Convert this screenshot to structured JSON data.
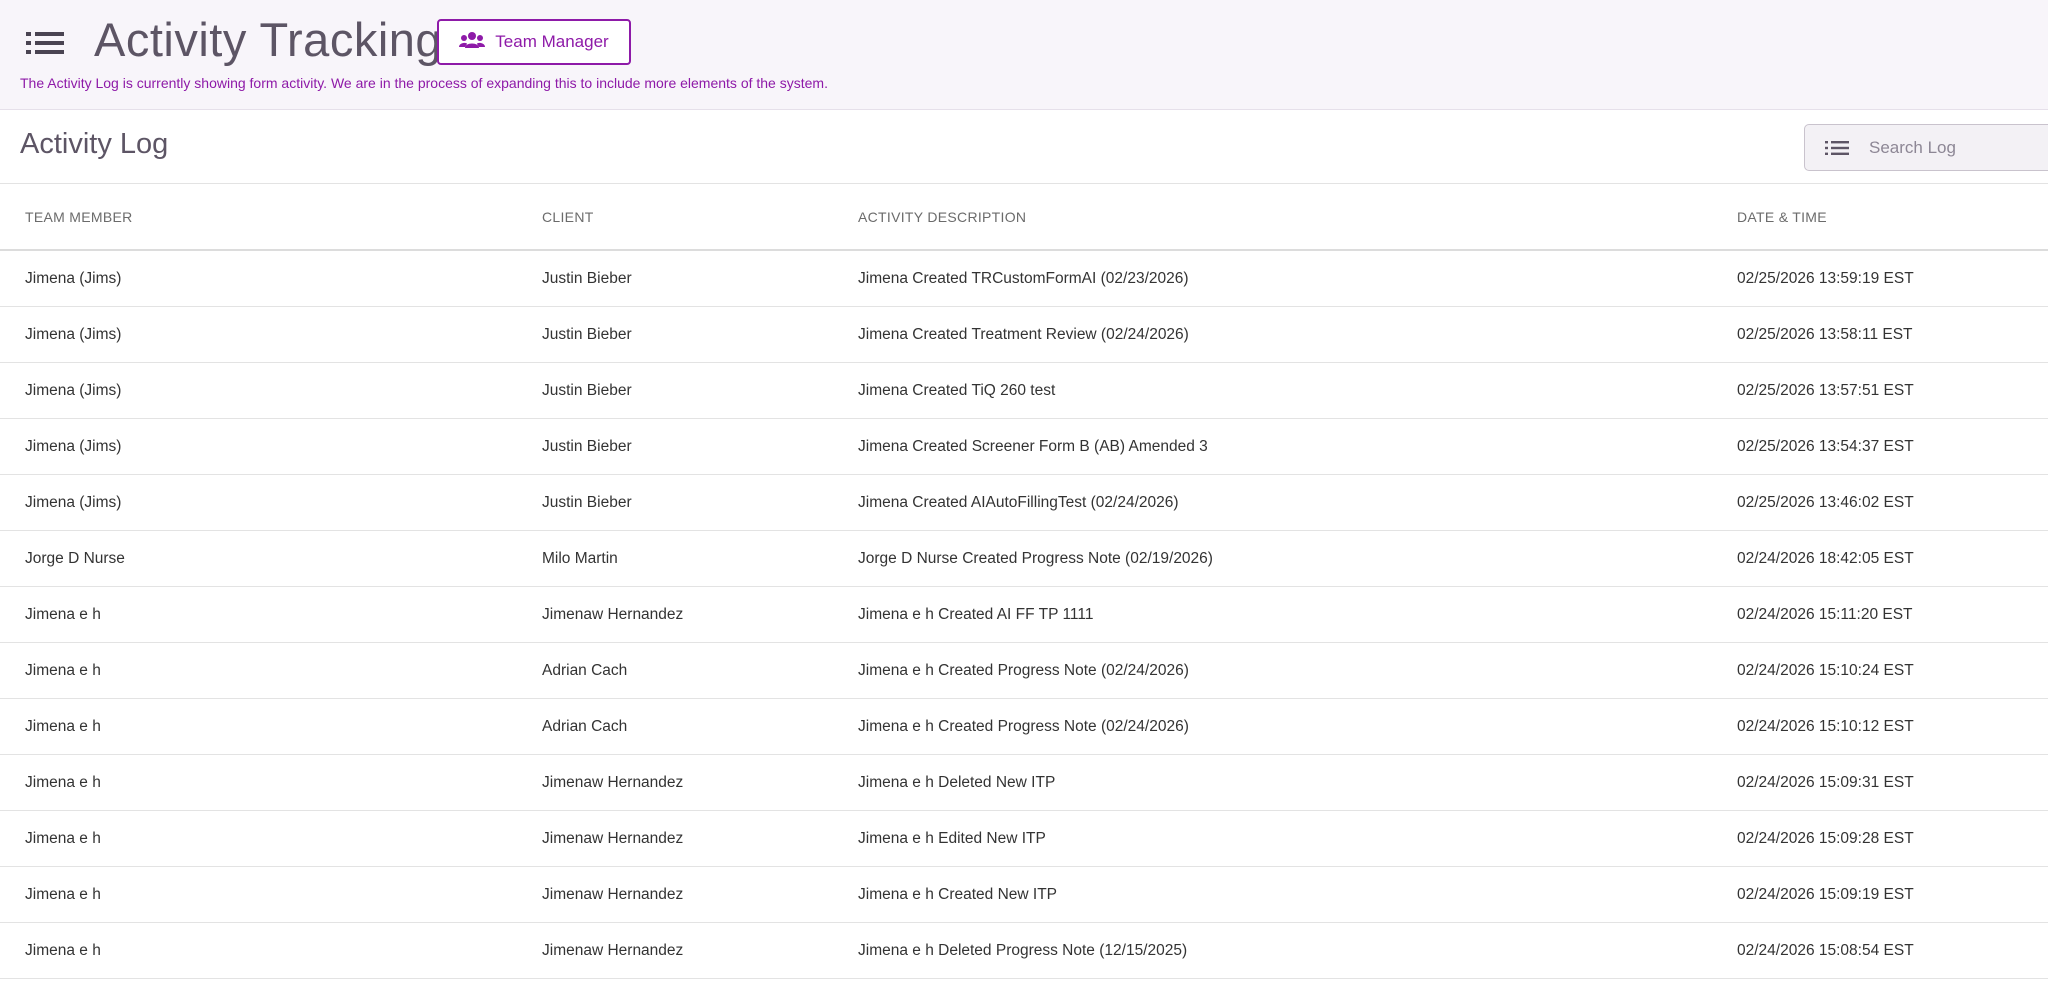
{
  "header": {
    "title": "Activity Tracking",
    "team_manager_label": "Team Manager",
    "notice": "The Activity Log is currently showing form activity. We are in the process of expanding this to include more elements of the system.",
    "accent_color": "#8e1aa8"
  },
  "log": {
    "title": "Activity Log",
    "search_placeholder": "Search Log"
  },
  "table": {
    "columns": [
      "TEAM MEMBER",
      "CLIENT",
      "ACTIVITY DESCRIPTION",
      "DATE & TIME"
    ],
    "rows": [
      [
        "Jimena (Jims)",
        "Justin Bieber",
        "Jimena Created TRCustomFormAI (02/23/2026)",
        "02/25/2026 13:59:19 EST"
      ],
      [
        "Jimena (Jims)",
        "Justin Bieber",
        "Jimena Created Treatment Review (02/24/2026)",
        "02/25/2026 13:58:11 EST"
      ],
      [
        "Jimena (Jims)",
        "Justin Bieber",
        "Jimena Created TiQ 260 test",
        "02/25/2026 13:57:51 EST"
      ],
      [
        "Jimena (Jims)",
        "Justin Bieber",
        "Jimena Created Screener Form B (AB) Amended 3",
        "02/25/2026 13:54:37 EST"
      ],
      [
        "Jimena (Jims)",
        "Justin Bieber",
        "Jimena Created AIAutoFillingTest (02/24/2026)",
        "02/25/2026 13:46:02 EST"
      ],
      [
        "Jorge D Nurse",
        "Milo Martin",
        "Jorge D Nurse Created Progress Note (02/19/2026)",
        "02/24/2026 18:42:05 EST"
      ],
      [
        "Jimena e h",
        "Jimenaw Hernandez",
        "Jimena e h Created AI FF TP 1111",
        "02/24/2026 15:11:20 EST"
      ],
      [
        "Jimena e h",
        "Adrian Cach",
        "Jimena e h Created Progress Note (02/24/2026)",
        "02/24/2026 15:10:24 EST"
      ],
      [
        "Jimena e h",
        "Adrian Cach",
        "Jimena e h Created Progress Note (02/24/2026)",
        "02/24/2026 15:10:12 EST"
      ],
      [
        "Jimena e h",
        "Jimenaw Hernandez",
        "Jimena e h Deleted New ITP",
        "02/24/2026 15:09:31 EST"
      ],
      [
        "Jimena e h",
        "Jimenaw Hernandez",
        "Jimena e h Edited New ITP",
        "02/24/2026 15:09:28 EST"
      ],
      [
        "Jimena e h",
        "Jimenaw Hernandez",
        "Jimena e h Created New ITP",
        "02/24/2026 15:09:19 EST"
      ],
      [
        "Jimena e h",
        "Jimenaw Hernandez",
        "Jimena e h Deleted Progress Note (12/15/2025)",
        "02/24/2026 15:08:54 EST"
      ]
    ]
  }
}
